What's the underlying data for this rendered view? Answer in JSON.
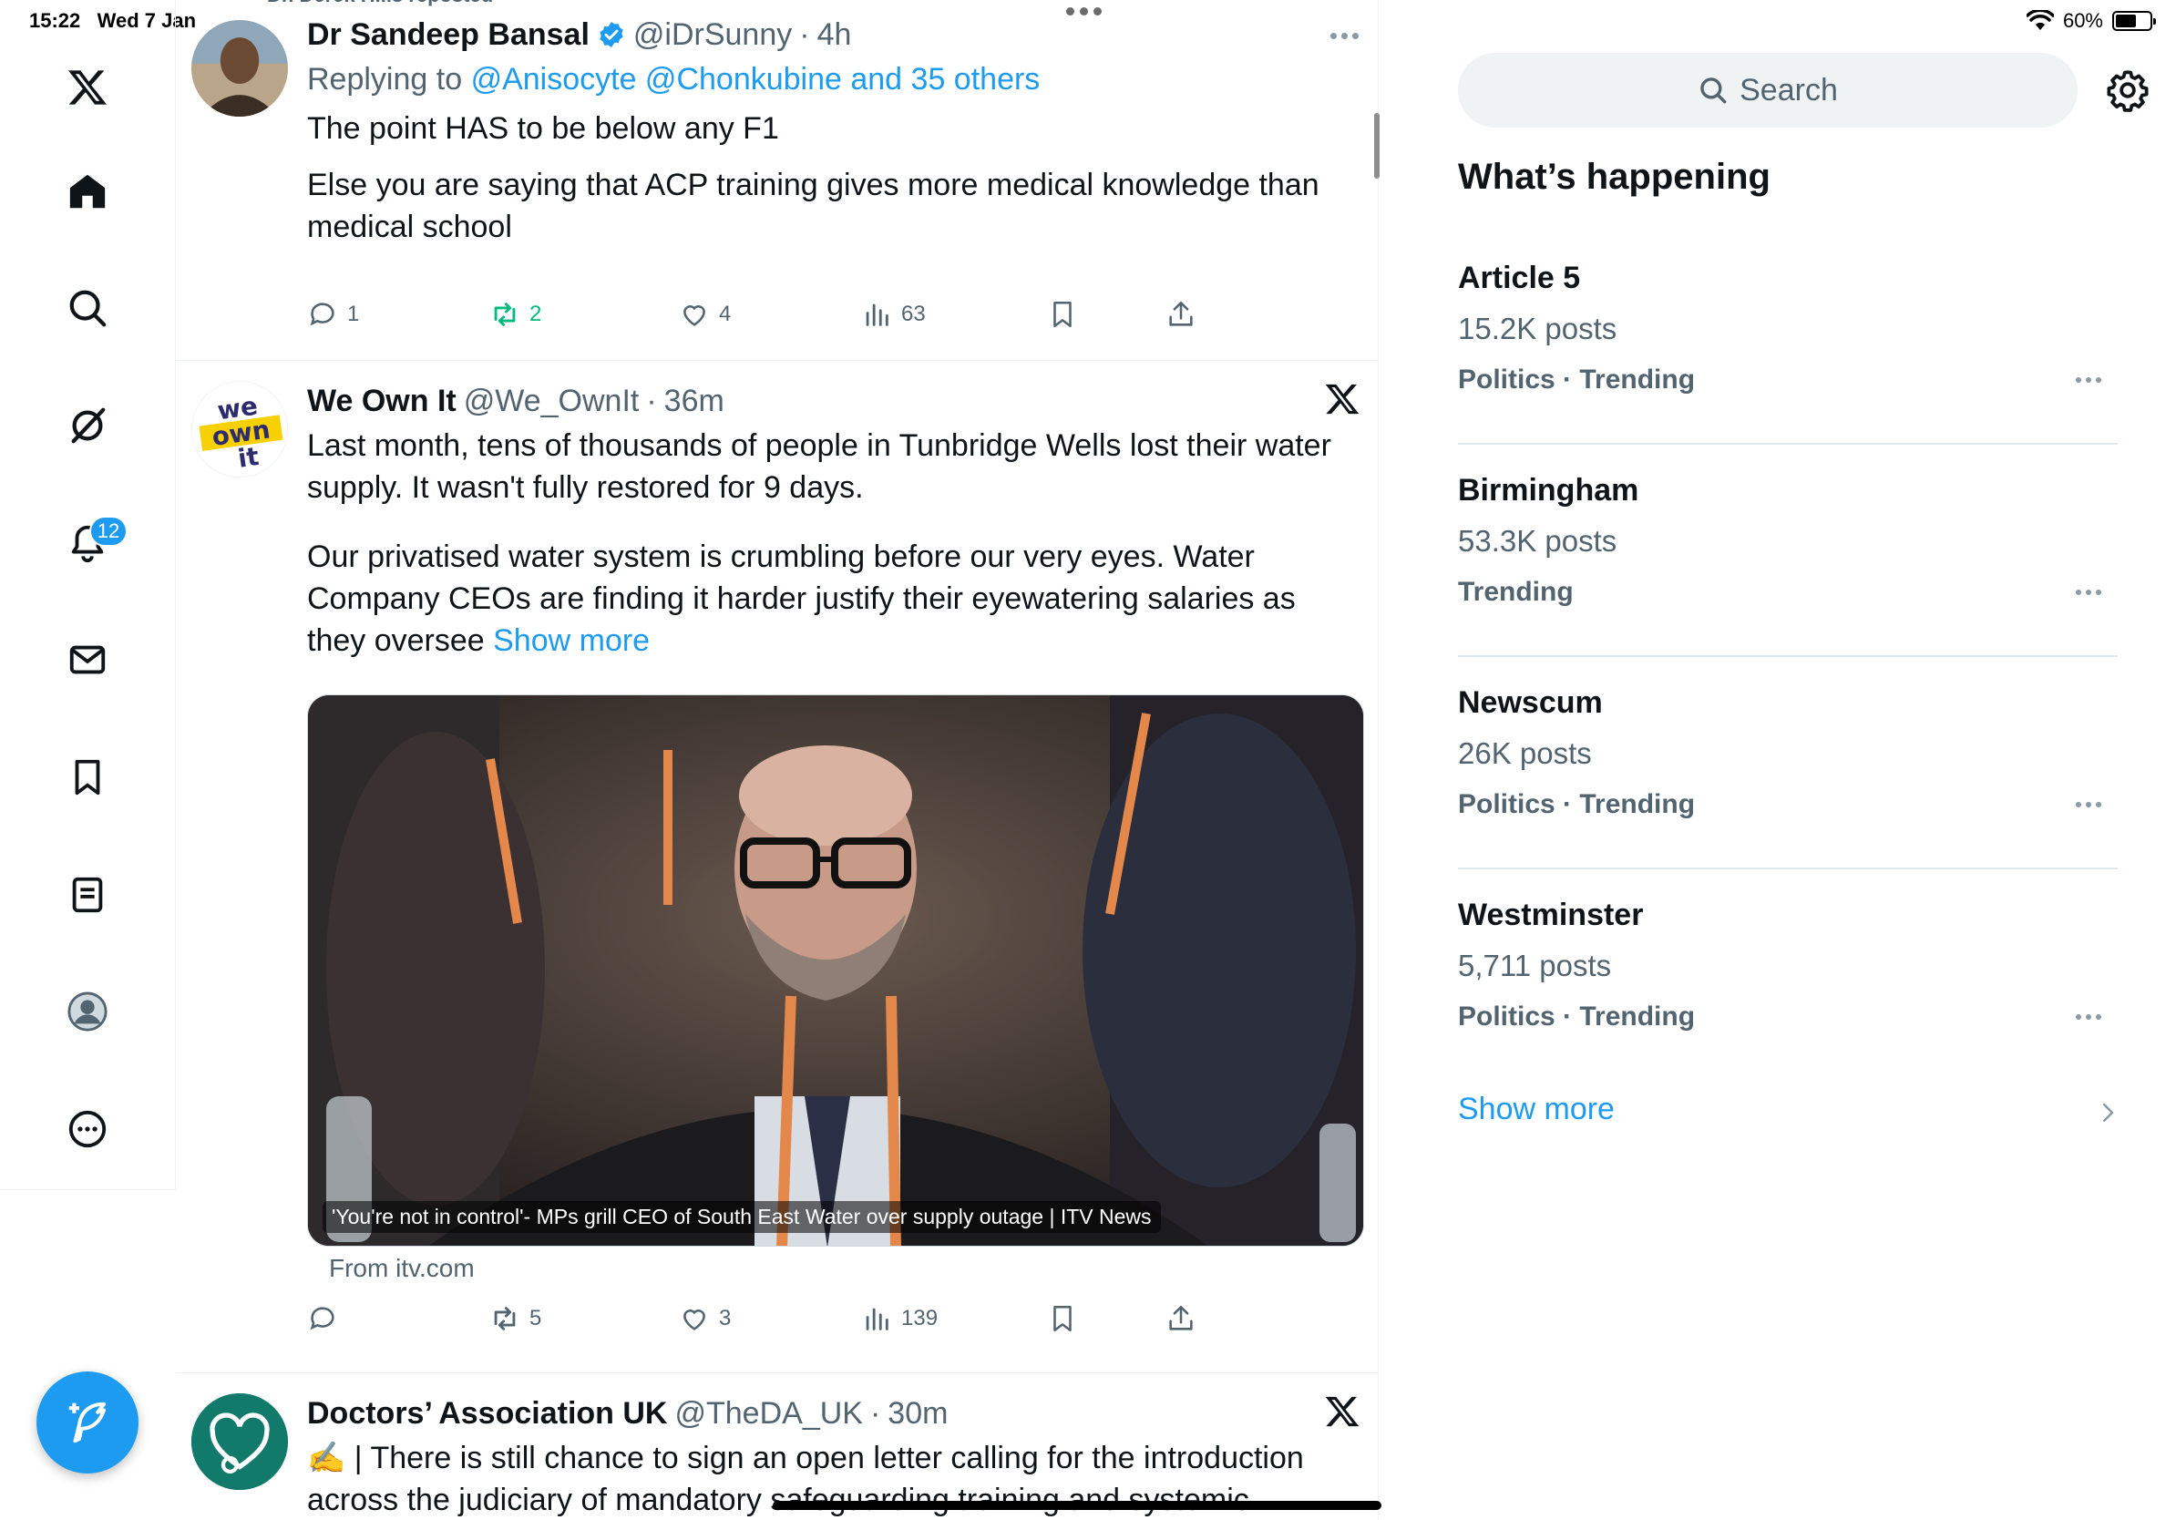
{
  "status_bar": {
    "time": "15:22",
    "date": "Wed 7 Jan",
    "battery": "60%",
    "battery_level": 0.6
  },
  "nav": {
    "items": [
      {
        "name": "x-logo-icon",
        "label": "X"
      },
      {
        "name": "home-icon",
        "label": "Home"
      },
      {
        "name": "search-icon",
        "label": "Explore"
      },
      {
        "name": "grok-icon",
        "label": "Grok"
      },
      {
        "name": "notifications-icon",
        "label": "Notifications"
      },
      {
        "name": "messages-icon",
        "label": "Messages"
      },
      {
        "name": "bookmarks-icon",
        "label": "Bookmarks"
      },
      {
        "name": "lists-icon",
        "label": "Lists"
      },
      {
        "name": "profile-icon",
        "label": "Profile"
      },
      {
        "name": "more-icon",
        "label": "More"
      }
    ],
    "notification_count": "12"
  },
  "feed": {
    "repost_note": "Dr. Derek Hills reposted",
    "tweets": [
      {
        "name": "Dr Sandeep Bansal",
        "handle": "@iDrSunny",
        "dot": "·",
        "time": "4h",
        "replying_prefix": "Replying to",
        "replying_to": "@Anisocyte @Chonkubine and 35 others",
        "text1": "The point HAS to be below any F1",
        "text2": "Else you are saying that ACP training gives more medical knowledge than medical school",
        "replies": "1",
        "reposts": "2",
        "likes": "4",
        "views": "63"
      },
      {
        "name": "We Own It",
        "handle": "@We_OwnIt",
        "dot": "·",
        "time": "36m",
        "text1": "Last month, tens of thousands of people in Tunbridge Wells lost their water supply. It wasn't fully restored for 9 days.",
        "text2": "Our privatised water system is crumbling before our very eyes. Water Company CEOs are finding it harder justify their eyewatering salaries as they oversee",
        "show_more": "Show more",
        "card_caption": "'You're not in control'- MPs grill CEO of South East Water over supply outage | ITV News",
        "card_source": "From itv.com",
        "replies": "",
        "reposts": "5",
        "likes": "3",
        "views": "139"
      },
      {
        "name": "Doctors’ Association UK",
        "handle": "@TheDA_UK",
        "dot": "·",
        "time": "30m",
        "text1": "✍️ | There is still chance to sign an open letter calling for the introduction across the judiciary of mandatory safeguarding training and systemic"
      }
    ]
  },
  "sidebar": {
    "search_placeholder": "Search",
    "heading": "What’s happening",
    "trends": [
      {
        "name": "Article 5",
        "posts": "15.2K posts",
        "meta": "Politics · Trending"
      },
      {
        "name": "Birmingham",
        "posts": "53.3K posts",
        "meta": "Trending"
      },
      {
        "name": "Newscum",
        "posts": "26K posts",
        "meta": "Politics · Trending"
      },
      {
        "name": "Westminster",
        "posts": "5,711 posts",
        "meta": "Politics · Trending"
      }
    ],
    "show_more": "Show more"
  },
  "colors": {
    "accent": "#1d9bf0",
    "secondary_text": "#536471",
    "repost_green": "#00ba7c"
  }
}
